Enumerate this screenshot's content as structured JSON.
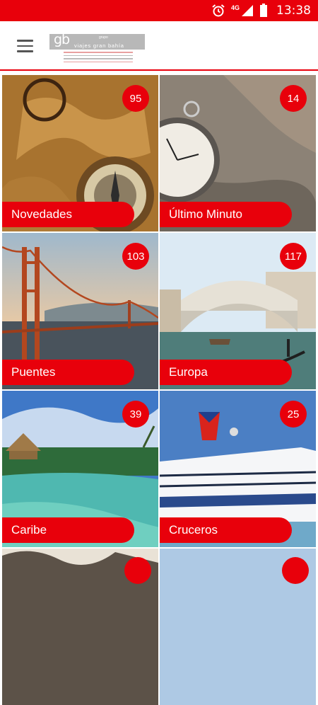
{
  "status": {
    "time": "13:38",
    "network": "4G"
  },
  "header": {
    "logo": {
      "initials": "gb",
      "grupo": "grupo",
      "brand": "viajes gran bahía"
    }
  },
  "colors": {
    "accent": "#e8000b"
  },
  "categories": [
    {
      "label": "Novedades",
      "count": "95",
      "scene": "antique-map-compass"
    },
    {
      "label": "Último Minuto",
      "count": "14",
      "scene": "pocket-watch-on-sand"
    },
    {
      "label": "Puentes",
      "count": "103",
      "scene": "golden-gate-bridge"
    },
    {
      "label": "Europa",
      "count": "117",
      "scene": "venice-rialto-bridge"
    },
    {
      "label": "Caribe",
      "count": "39",
      "scene": "tropical-lagoon"
    },
    {
      "label": "Cruceros",
      "count": "25",
      "scene": "cruise-ship"
    },
    {
      "label": "",
      "count": "",
      "scene": "rocky-landscape"
    },
    {
      "label": "",
      "count": "",
      "scene": "sky"
    }
  ]
}
